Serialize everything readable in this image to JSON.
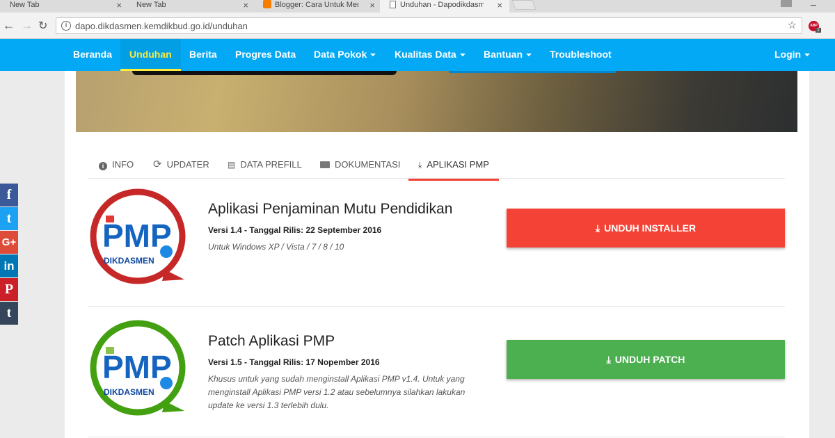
{
  "browser": {
    "tabs": [
      {
        "title": "New Tab"
      },
      {
        "title": "New Tab"
      },
      {
        "title": "Blogger: Cara Untuk Men"
      },
      {
        "title": "Unduhan - Dapodikdasm"
      }
    ],
    "url": "dapo.dikdasmen.kemdikbud.go.id/unduhan",
    "extension_badge": "ABP",
    "extension_count": "1"
  },
  "navbar": {
    "items": [
      {
        "label": "Beranda"
      },
      {
        "label": "Unduhan"
      },
      {
        "label": "Berita"
      },
      {
        "label": "Progres Data"
      },
      {
        "label": "Data Pokok"
      },
      {
        "label": "Kualitas Data"
      },
      {
        "label": "Bantuan"
      },
      {
        "label": "Troubleshoot"
      }
    ],
    "login": "Login",
    "active_color": "#ffeb3b",
    "bg_color": "#03a9f4"
  },
  "content_tabs": [
    {
      "label": "INFO",
      "icon": "info-icon"
    },
    {
      "label": "UPDATER",
      "icon": "refresh-icon"
    },
    {
      "label": "DATA PREFILL",
      "icon": "table-icon"
    },
    {
      "label": "DOKUMENTASI",
      "icon": "folder-icon"
    },
    {
      "label": "APLIKASI PMP",
      "icon": "download-icon"
    }
  ],
  "items": [
    {
      "title": "Aplikasi Penjaminan Mutu Pendidikan",
      "version": "Versi 1.4 - Tanggal Rilis: 22 September 2016",
      "desc": "Untuk Windows XP / Vista / 7 / 8 / 10",
      "button": "UNDUH INSTALLER",
      "button_color": "#f44336",
      "logo_text": "PMP",
      "logo_sub": "DIKDASMEN",
      "logo_color": "#c62828"
    },
    {
      "title": "Patch Aplikasi PMP",
      "version": "Versi 1.5 - Tanggal Rilis: 17 Nopember 2016",
      "desc": "Khusus untuk yang sudah menginstall Aplikasi PMP v1.4. Untuk yang menginstall Aplikasi PMP versi 1.2 atau sebelumnya silahkan lakukan update ke versi 1.3 terlebih dulu.",
      "button": "UNDUH PATCH",
      "button_color": "#4caf50",
      "logo_text": "PMP",
      "logo_sub": "DIKDASMEN",
      "logo_color": "#43a010"
    }
  ],
  "social": [
    {
      "glyph": "f",
      "name": "facebook-icon",
      "color": "#3b5998"
    },
    {
      "glyph": "t",
      "name": "twitter-icon",
      "color": "#1da1f2"
    },
    {
      "glyph": "G+",
      "name": "googleplus-icon",
      "color": "#dd4b39"
    },
    {
      "glyph": "in",
      "name": "linkedin-icon",
      "color": "#0077b5"
    },
    {
      "glyph": "P",
      "name": "pinterest-icon",
      "color": "#cb2027"
    },
    {
      "glyph": "t",
      "name": "tumblr-icon",
      "color": "#35465c"
    }
  ]
}
